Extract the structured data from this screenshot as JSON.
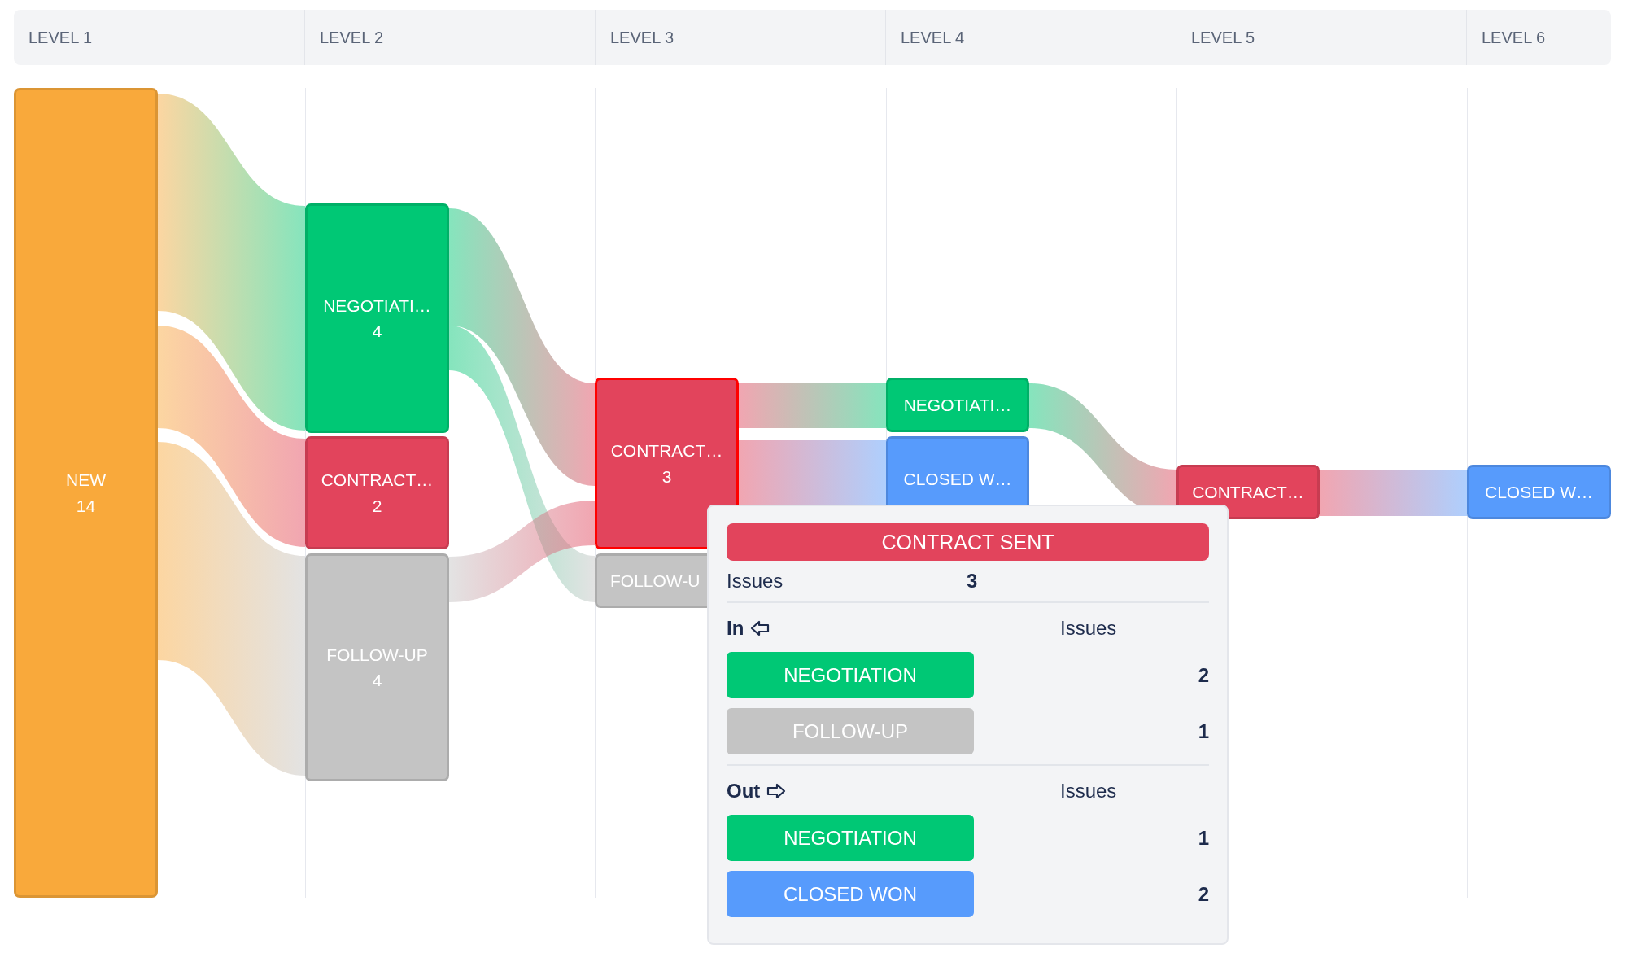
{
  "columns": [
    {
      "label": "LEVEL 1",
      "nodes": [
        {
          "label": "NEW",
          "count": "14",
          "color": "#f9a93b",
          "selected": false
        }
      ]
    },
    {
      "label": "LEVEL 2",
      "nodes": [
        {
          "label": "NEGOTIATI…",
          "count": "4",
          "color": "#00c875",
          "selected": false
        },
        {
          "label": "CONTRACT…",
          "count": "2",
          "color": "#e2445c",
          "selected": false
        },
        {
          "label": "FOLLOW-UP",
          "count": "4",
          "color": "#c4c4c4",
          "selected": false
        }
      ]
    },
    {
      "label": "LEVEL 3",
      "nodes": [
        {
          "label": "CONTRACT…",
          "count": "3",
          "color": "#e2445c",
          "selected": true
        },
        {
          "label": "FOLLOW-U",
          "color": "#c4c4c4",
          "selected": false
        }
      ]
    },
    {
      "label": "LEVEL 4",
      "nodes": [
        {
          "label": "NEGOTIATI…",
          "color": "#00c875",
          "selected": false
        },
        {
          "label": "CLOSED W…",
          "color": "#579bfc",
          "selected": false
        }
      ]
    },
    {
      "label": "LEVEL 5",
      "nodes": [
        {
          "label": "CONTRACT…",
          "color": "#e2445c",
          "selected": false
        }
      ]
    },
    {
      "label": "LEVEL 6",
      "nodes": [
        {
          "label": "CLOSED W…",
          "color": "#579bfc",
          "selected": false
        }
      ]
    }
  ],
  "tooltip": {
    "title": "CONTRACT SENT",
    "color": "#e2445c",
    "summary": {
      "label": "Issues",
      "value": "3"
    },
    "sections": [
      {
        "kind": "in",
        "heading": "In",
        "column": "Issues",
        "rows": [
          {
            "label": "NEGOTIATION",
            "count": "2",
            "color": "#00c875"
          },
          {
            "label": "FOLLOW-UP",
            "count": "1",
            "color": "#c4c4c4"
          }
        ]
      },
      {
        "kind": "out",
        "heading": "Out",
        "column": "Issues",
        "rows": [
          {
            "label": "NEGOTIATION",
            "count": "1",
            "color": "#00c875"
          },
          {
            "label": "CLOSED WON",
            "count": "2",
            "color": "#579bfc"
          }
        ]
      }
    ]
  }
}
